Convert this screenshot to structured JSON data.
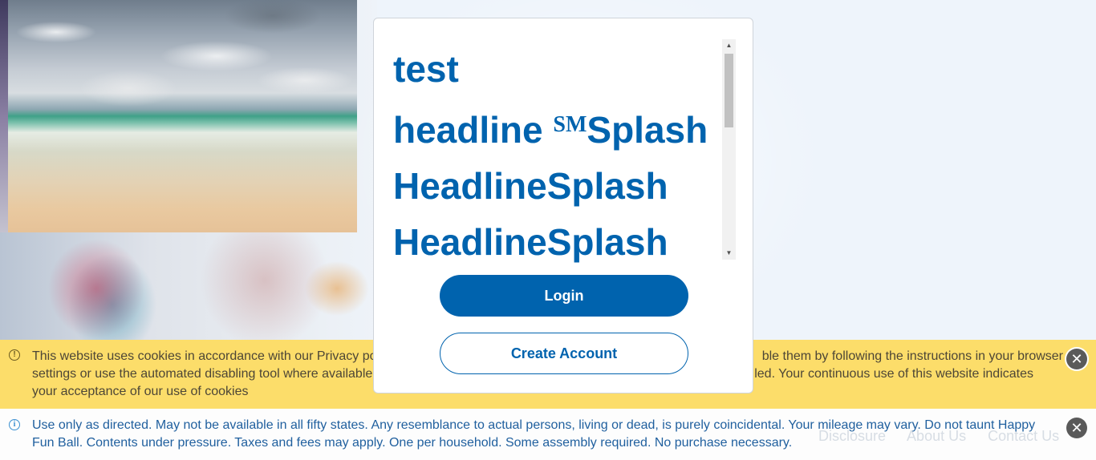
{
  "modal": {
    "headline_lines": [
      "test",
      "headline",
      "Splash",
      "HeadlineSplash",
      "HeadlineSplash"
    ],
    "service_mark": "SM",
    "login_label": "Login",
    "create_account_label": "Create Account"
  },
  "cookie_banner": {
    "text": "This website uses cookies in accordance with our Privacy po… ble them by following the instructions in your browser settings or use the automated disabling tool where available… led. Your continuous use of this website indicates your acceptance of our use of cookies",
    "text_visible_left_1": "This website uses cookies in accordance with our Privacy po",
    "text_visible_right_1": "ble them by following the instructions in your browser",
    "text_visible_left_2": "settings or use the automated disabling tool where available",
    "text_visible_right_2": "led. Your continuous use of this website indicates",
    "text_line_3": "your acceptance of our use of cookies",
    "close_icon": "close-icon"
  },
  "disclaimer": {
    "text": "Use only as directed. May not be available in all fifty states. Any resemblance to actual persons, living or dead, is purely coincidental. Your mileage may vary. Do not taunt Happy Fun Ball. Contents under pressure. Taxes and fees may apply. One per household. Some assembly required. No purchase necessary.",
    "close_icon": "close-icon"
  },
  "footer": {
    "links": [
      "Disclosure",
      "About Us",
      "Contact Us"
    ]
  },
  "colors": {
    "primary": "#0063ae",
    "cookie_bg": "#fcdd6a",
    "disclaimer_text": "#1f5f9e"
  }
}
